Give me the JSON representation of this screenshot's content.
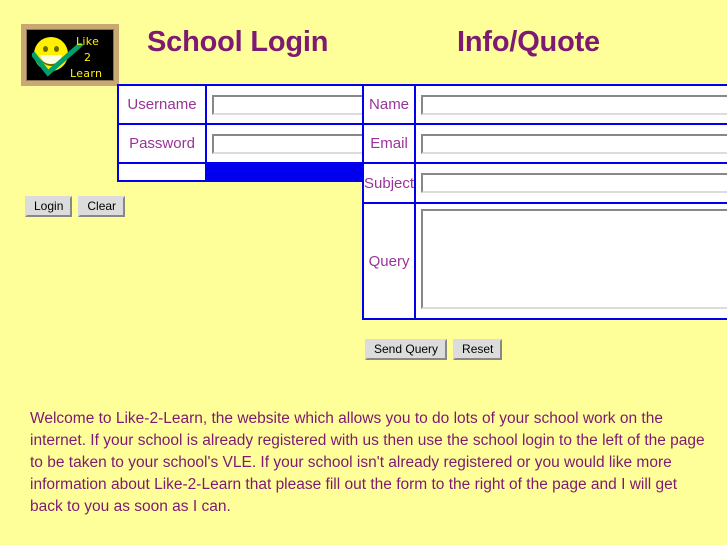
{
  "page": {
    "background_color": "#FFFF99",
    "heading_color": "#7E1A72",
    "label_color": "#993399",
    "table_border_color": "#0000EE"
  },
  "logo": {
    "alt": "Like 2 Learn blackboard logo",
    "line1": "Like",
    "line2": "2",
    "line3": "Learn",
    "board_color": "#000000",
    "frame_color": "#C9A876",
    "text_color": "#FFF000",
    "tick_color": "#00A06A"
  },
  "headings": {
    "login": "School Login",
    "info": "Info/Quote"
  },
  "login_form": {
    "rows": [
      {
        "label": "Username",
        "value": "",
        "placeholder": "",
        "type": "text"
      },
      {
        "label": "Password",
        "value": "",
        "placeholder": "",
        "type": "password"
      }
    ],
    "buttons": {
      "submit": "Login",
      "reset": "Clear"
    }
  },
  "info_form": {
    "rows": [
      {
        "label": "Name",
        "value": "",
        "placeholder": "",
        "type": "text"
      },
      {
        "label": "Email",
        "value": "",
        "placeholder": "",
        "type": "text"
      },
      {
        "label": "Subject",
        "value": "",
        "placeholder": "",
        "type": "text"
      },
      {
        "label": "Query",
        "value": "",
        "placeholder": "",
        "type": "textarea"
      }
    ],
    "buttons": {
      "submit": "Send Query",
      "reset": "Reset"
    }
  },
  "welcome": {
    "text": "Welcome to Like-2-Learn, the website which allows you to do lots of your school work on the internet. If your school is already registered with us then use the school login to the left of the page to be taken to your school's VLE. If your school isn't already registered or you would like more information about Like-2-Learn that please fill out the form to the right of the page and I will get back to you as soon as I can."
  }
}
